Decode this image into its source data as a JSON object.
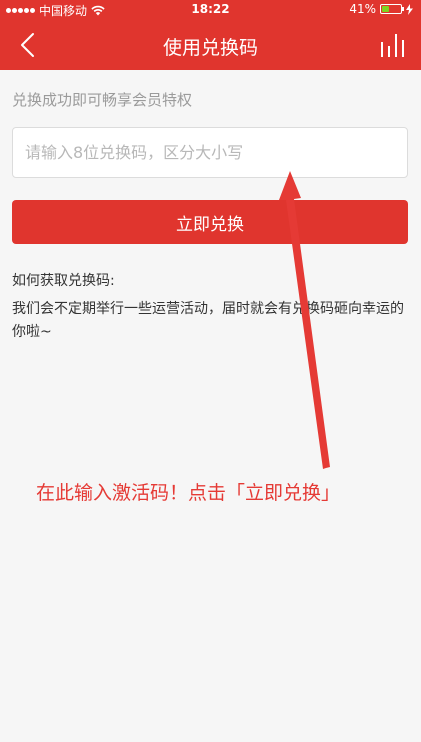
{
  "status_bar": {
    "carrier": "中国移动",
    "time": "18:22",
    "battery_level": "41%",
    "battery_fraction": 0.41,
    "battery_color": "#7ed321"
  },
  "nav": {
    "title": "使用兑换码",
    "back_icon": "chevron-left-icon",
    "stats_icon": "bar-stats-icon"
  },
  "form": {
    "hint": "兑换成功即可畅享会员特权",
    "input_placeholder": "请输入8位兑换码，区分大小写",
    "input_value": "",
    "submit_label": "立即兑换"
  },
  "info": {
    "title": "如何获取兑换码:",
    "body": "我们会不定期举行一些运营活动，届时就会有兑换码砸向幸运的你啦~"
  },
  "annotation": {
    "text": "在此输入激活码！点击「立即兑换」"
  },
  "colors": {
    "brand_red": "#e0352e",
    "annotation_red": "#e53a35",
    "background": "#f6f6f6"
  }
}
